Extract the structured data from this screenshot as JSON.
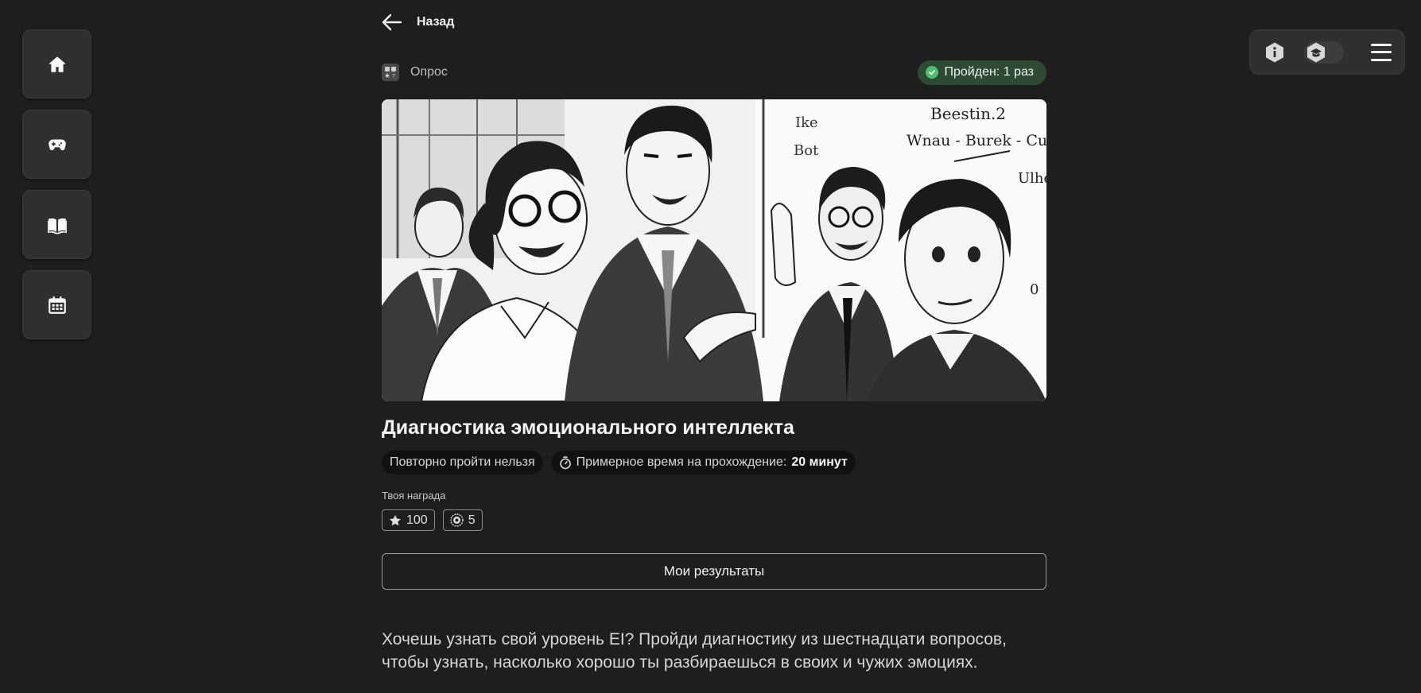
{
  "sidebar": {
    "items": [
      {
        "icon": "home-icon"
      },
      {
        "icon": "gamepad-icon"
      },
      {
        "icon": "book-icon"
      },
      {
        "icon": "calendar-icon"
      }
    ]
  },
  "topbar": {
    "icons": [
      "info-icon",
      "graduation-cap-icon",
      "menu-icon"
    ]
  },
  "nav": {
    "back_label": "Назад"
  },
  "survey": {
    "type_label": "Опрос",
    "status": "Пройден: 1 раз",
    "status_color": "#4ac06a",
    "title": "Диагностика эмоционального интеллекта",
    "chip_retake": "Повторно пройти нельзя",
    "chip_time_prefix": "Примерное время на прохождение:",
    "chip_time_value": "20 минут",
    "reward_label": "Твоя награда",
    "reward_points": "100",
    "reward_coins": "5",
    "results_button": "Мои результаты",
    "description": "Хочешь узнать свой уровень EI? Пройди диагностику из шестнадцати вопросов, чтобы узнать, насколько хорошо ты разбираешься в своих и чужих эмоциях."
  },
  "hero_image": {
    "board_texts": [
      "Ike",
      "Bot",
      "Beestin.2",
      "Wnau - Burek - Cu",
      "Ulhe",
      "0"
    ]
  }
}
